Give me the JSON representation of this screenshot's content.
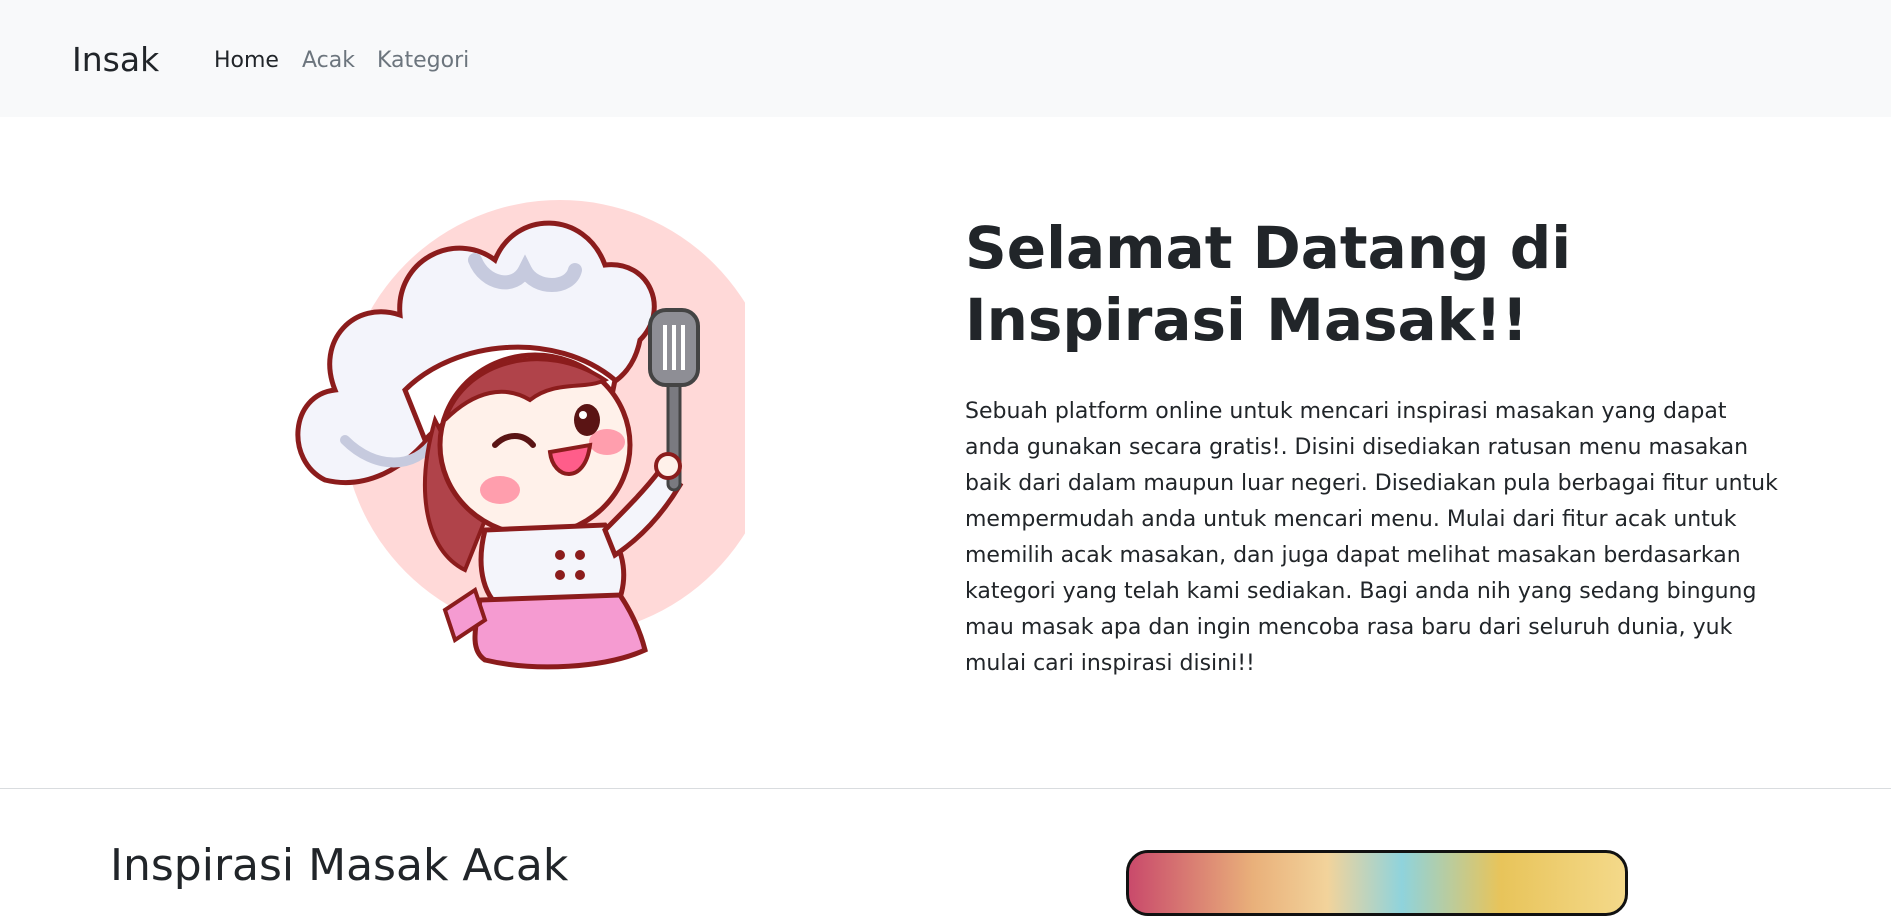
{
  "navbar": {
    "brand": "Insak",
    "links": [
      {
        "label": "Home",
        "active": true
      },
      {
        "label": "Acak",
        "active": false
      },
      {
        "label": "Kategori",
        "active": false
      }
    ]
  },
  "hero": {
    "illustration": "chef-girl-illustration",
    "title": "Selamat Datang di Inspirasi Masak!!",
    "description": "Sebuah platform online untuk mencari inspirasi masakan yang dapat anda gunakan secara gratis!. Disini disediakan ratusan menu masakan baik dari dalam maupun luar negeri. Disediakan pula berbagai fitur untuk mempermudah anda untuk mencari menu. Mulai dari fitur acak untuk memilih acak masakan, dan juga dapat melihat masakan berdasarkan kategori yang telah kami sediakan. Bagi anda nih yang sedang bingung mau masak apa dan ingin mencoba rasa baru dari seluruh dunia, yuk mulai cari inspirasi disini!!"
  },
  "random_section": {
    "title": "Inspirasi Masak Acak",
    "image": "food-photo"
  },
  "colors": {
    "navbar_bg": "#f8f9fa",
    "text": "#212529",
    "muted": "#6c757d",
    "illustration_circle": "#ffd9d8"
  }
}
